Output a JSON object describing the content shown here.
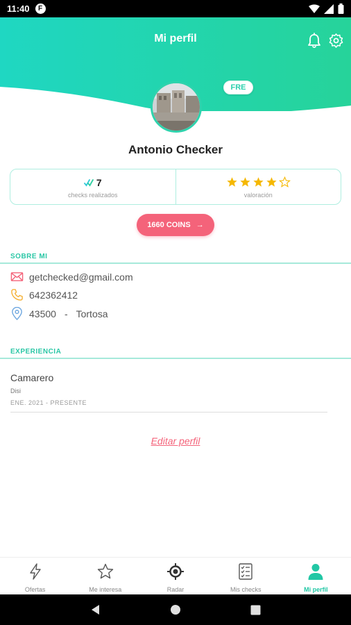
{
  "status_bar": {
    "time": "11:40",
    "notification_badge": "F",
    "icons": [
      "wifi-icon",
      "signal-icon",
      "battery-icon"
    ]
  },
  "header": {
    "title": "Mi perfil",
    "icons": [
      "bell-icon",
      "gear-icon"
    ]
  },
  "profile": {
    "badge": "FRE",
    "name": "Antonio Checker"
  },
  "stats": {
    "checks_value": "7",
    "checks_label": "checks realizados",
    "rating_label": "valoración",
    "rating_value": 4,
    "rating_max": 5
  },
  "coins": {
    "label": "1660 COINS",
    "arrow": "→"
  },
  "about": {
    "title": "SOBRE MI",
    "email": "getchecked@gmail.com",
    "phone": "642362412",
    "postal_code": "43500",
    "separator": "-",
    "city": "Tortosa"
  },
  "experience": {
    "title": "EXPERIENCIA",
    "items": [
      {
        "role": "Camarero",
        "company": "Disi",
        "dates": "ENE. 2021 - PRESENTE"
      }
    ]
  },
  "edit_link": "Editar perfil",
  "bottom_nav": {
    "items": [
      {
        "label": "Ofertas",
        "icon": "lightning-icon"
      },
      {
        "label": "Me interesa",
        "icon": "star-icon"
      },
      {
        "label": "Radar",
        "icon": "radar-icon"
      },
      {
        "label": "Mis checks",
        "icon": "checklist-icon"
      },
      {
        "label": "Mi perfil",
        "icon": "user-icon",
        "active": true
      }
    ]
  },
  "colors": {
    "accent": "#2ed3ad",
    "accent_dark": "#1fcfb5",
    "coins": "#f4637a",
    "star": "#f5b800"
  }
}
